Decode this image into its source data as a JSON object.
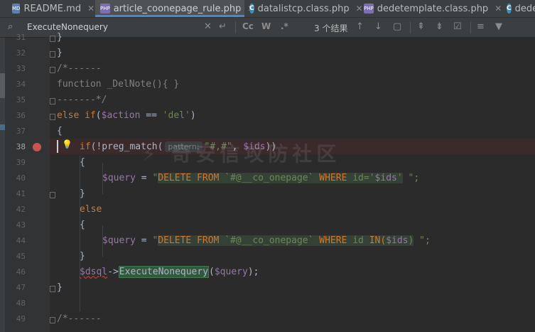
{
  "tabs": [
    {
      "label": "README.md",
      "icon": "md-file-icon",
      "active": false
    },
    {
      "label": "article_coonepage_rule.php",
      "icon": "php-file-icon",
      "active": true
    },
    {
      "label": "datalistcp.class.php",
      "icon": "class-file-icon",
      "active": false
    },
    {
      "label": "dedetemplate.class.php",
      "icon": "php-file-icon",
      "active": false
    },
    {
      "label": "dede",
      "icon": "class-file-icon",
      "active": false
    }
  ],
  "search": {
    "query": "ExecuteNonequery",
    "match_case_label": "Cc",
    "words_label": "W",
    "regex_label": ".*",
    "result_count": "3 个结果"
  },
  "line_numbers": [
    "31",
    "32",
    "33",
    "34",
    "35",
    "36",
    "37",
    "38",
    "39",
    "40",
    "41",
    "42",
    "43",
    "44",
    "45",
    "46",
    "47",
    "48",
    "49"
  ],
  "code": {
    "l31": "}",
    "l32": "}",
    "l33": "/*------",
    "l34_kw": "function",
    "l34_rest": " _DelNote(){ }",
    "l35": "-------*/",
    "l36_else": "else",
    "l36_if": " if",
    "l36_open": "(",
    "l36_var": "$action",
    "l36_eq": " == ",
    "l36_str": "'del'",
    "l36_close": ")",
    "l37": "{",
    "l38_if": "if",
    "l38_call": "(!preg_match(",
    "l38_hint": "pattern:",
    "l38_str": "\"#,#\"",
    "l38_comma": ", ",
    "l38_var": "$ids",
    "l38_end": "))",
    "l39": "{",
    "l40_var": "$query",
    "l40_eq": " = ",
    "l40_q1": "\"",
    "l40_sql1": "DELETE FROM ",
    "l40_tbl": "`#@__co_onepage`",
    "l40_sql2": " WHERE ",
    "l40_col": "id",
    "l40_eq2": "=",
    "l40_q2": "'",
    "l40_v": "$ids",
    "l40_q3": "'",
    "l40_end": " \";",
    "l41": "}",
    "l42": "else",
    "l43": "{",
    "l44_var": "$query",
    "l44_eq": " = ",
    "l44_q1": "\"",
    "l44_sql1": "DELETE FROM ",
    "l44_tbl": "`#@__co_onepage`",
    "l44_sql2": " WHERE ",
    "l44_col": "id",
    "l44_in": " IN(",
    "l44_v": "$ids",
    "l44_close": ")",
    "l44_end": " \";",
    "l45": "}",
    "l46_var": "$dsql",
    "l46_arrow": "->",
    "l46_fn": "ExecuteNonequery",
    "l46_open": "(",
    "l46_arg": "$query",
    "l46_end": ");",
    "l47": "}",
    "l49": "/*------"
  }
}
